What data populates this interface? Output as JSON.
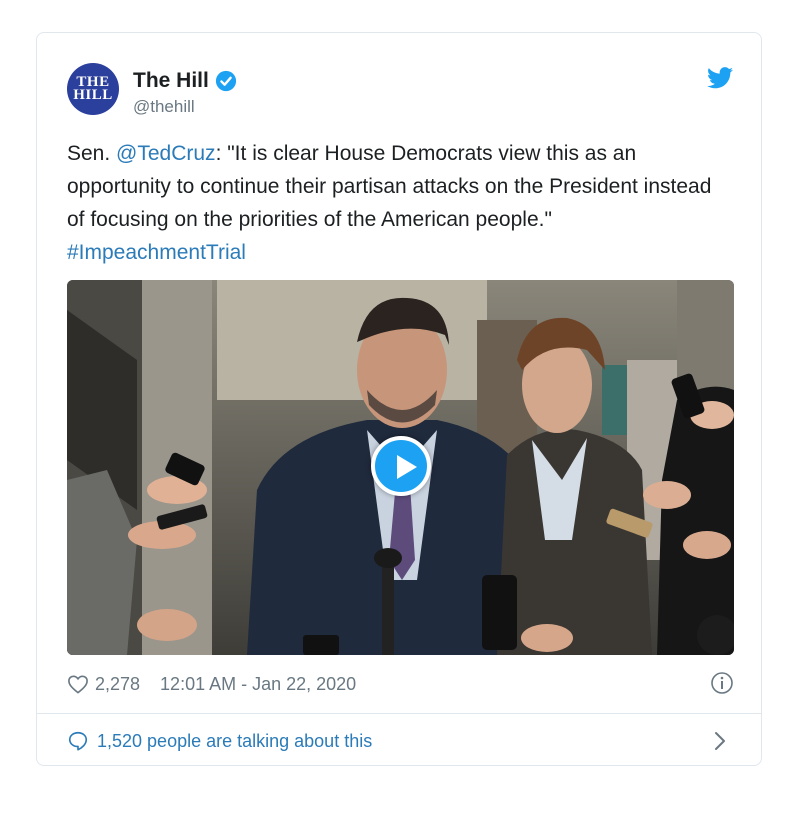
{
  "account": {
    "avatar_text": "THE HILL",
    "display_name": "The Hill",
    "handle": "@thehill",
    "verified": true
  },
  "tweet": {
    "prefix": "Sen. ",
    "mention": "@TedCruz",
    "body": ": \"It is clear House Democrats view this as an opportunity to continue their partisan attacks on the President instead of focusing on the priorities of the American people.\"",
    "hashtag": "#ImpeachmentTrial"
  },
  "media": {
    "type": "video",
    "play_icon": "play-icon"
  },
  "meta": {
    "likes": "2,278",
    "timestamp": "12:01 AM - Jan 22, 2020"
  },
  "conversation": {
    "label": "1,520 people are talking about this"
  },
  "colors": {
    "link": "#2b7bb9",
    "twitter_blue": "#1da1f2",
    "muted": "#697882",
    "avatar_bg": "#2b3f9c"
  }
}
